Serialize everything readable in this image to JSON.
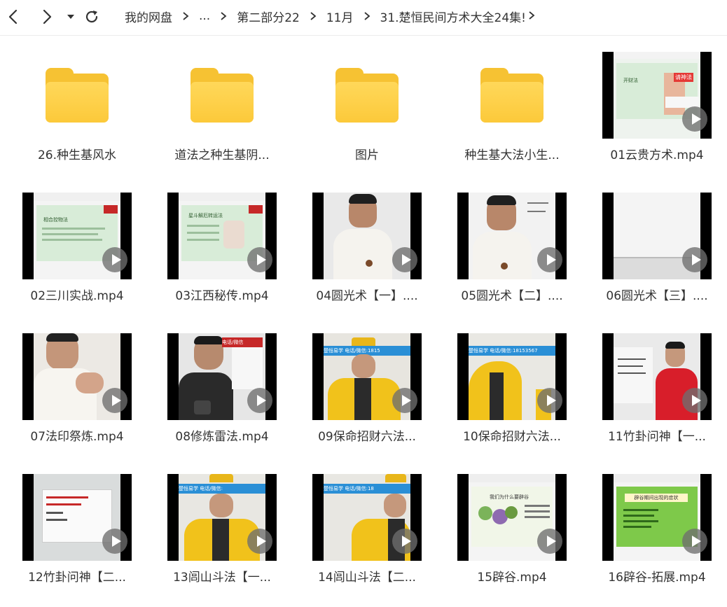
{
  "toolbar": {
    "back_icon": "chevron-left-icon",
    "forward_icon": "chevron-right-icon",
    "history_icon": "caret-down-icon",
    "refresh_icon": "refresh-icon"
  },
  "breadcrumb": {
    "items": [
      "我的网盘",
      "...",
      "第二部分22",
      "11月",
      "31.楚恒民间方术大全24集!"
    ]
  },
  "files": [
    {
      "name": "26.种生基风水",
      "type": "folder"
    },
    {
      "name": "道法之种生基阴...",
      "type": "folder"
    },
    {
      "name": "图片",
      "type": "folder"
    },
    {
      "name": "种生基大法小生...",
      "type": "folder"
    },
    {
      "name": "01云贵方术.mp4",
      "type": "video",
      "thumb_banner": "请神法",
      "thumb_caption": "开财法"
    },
    {
      "name": "02三川实战.mp4",
      "type": "video",
      "thumb_caption": "相合控物法"
    },
    {
      "name": "03江西秘传.mp4",
      "type": "video",
      "thumb_caption": "星斗解厄转运法"
    },
    {
      "name": "04圆光术【一】....",
      "type": "video"
    },
    {
      "name": "05圆光术【二】....",
      "type": "video"
    },
    {
      "name": "06圆光术【三】....",
      "type": "video"
    },
    {
      "name": "07法印祭炼.mp4",
      "type": "video"
    },
    {
      "name": "08修炼雷法.mp4",
      "type": "video",
      "thumb_banner": "电话/微信"
    },
    {
      "name": "09保命招财六法...",
      "type": "video",
      "thumb_banner": "楚恒易学 电话/微信:1815"
    },
    {
      "name": "10保命招财六法...",
      "type": "video",
      "thumb_banner": "楚恒易学 电话/微信:18153567"
    },
    {
      "name": "11竹卦问神【一...",
      "type": "video"
    },
    {
      "name": "12竹卦问神【二...",
      "type": "video"
    },
    {
      "name": "13闾山斗法【一...",
      "type": "video",
      "thumb_banner": "楚恒易学 电话/微信:"
    },
    {
      "name": "14闾山斗法【二...",
      "type": "video",
      "thumb_banner": "楚恒易学 电话/微信:18"
    },
    {
      "name": "15辟谷.mp4",
      "type": "video",
      "thumb_caption": "我们为什么要辟谷"
    },
    {
      "name": "16辟谷-拓展.mp4",
      "type": "video",
      "thumb_caption": "辟谷期间出现的症状"
    }
  ],
  "colors": {
    "folder": "#f6c233",
    "folder_front": "#fcc93a",
    "slide_green": "#d8ecd8",
    "banner_blue": "#2a8fd6",
    "robe_yellow": "#f1c21b",
    "robe_red": "#d81e2a"
  }
}
